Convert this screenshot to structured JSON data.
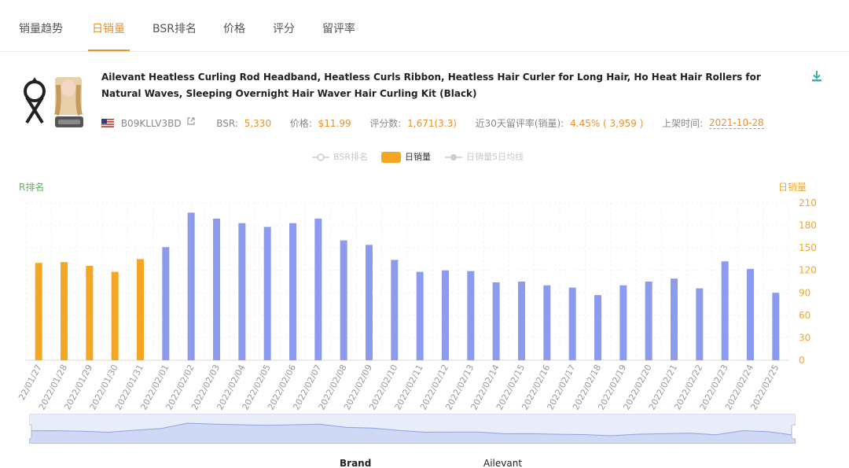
{
  "tabs": [
    {
      "label": "销量趋势",
      "active": false
    },
    {
      "label": "日销量",
      "active": true
    },
    {
      "label": "BSR排名",
      "active": false
    },
    {
      "label": "价格",
      "active": false
    },
    {
      "label": "评分",
      "active": false
    },
    {
      "label": "留评率",
      "active": false
    }
  ],
  "product": {
    "title": "Ailevant Heatless Curling Rod Headband, Heatless Curls Ribbon, Heatless Hair Curler for Long Hair, Ho Heat Hair Rollers for Natural Waves, Sleeping Overnight Hair Waver Hair Curling Kit (Black)",
    "asin": "B09KLLV3BD",
    "bsr_label": "BSR:",
    "bsr_value": "5,330",
    "price_label": "价格:",
    "price_value": "$11.99",
    "ratings_label": "评分数:",
    "ratings_value": "1,671(3.3)",
    "review_rate_label": "近30天留评率(销量):",
    "review_rate_value": "4.45% ( 3,959 )",
    "listed_label": "上架时间:",
    "listed_value": "2021-10-28"
  },
  "colors": {
    "accent": "#e8922b",
    "bar_highlight": "#f5a623",
    "bar_default": "#8d9bef",
    "left_axis": "#5cb85c",
    "right_axis": "#f5a623"
  },
  "chart_data": {
    "type": "bar",
    "legend": [
      {
        "name": "BSR排名",
        "enabled": false
      },
      {
        "name": "日销量",
        "enabled": true
      },
      {
        "name": "日销量5日均线",
        "enabled": false
      }
    ],
    "ylabel_left": "R排名",
    "ylabel_right": "日销量",
    "ylim": [
      0,
      210
    ],
    "yticks": [
      210,
      180,
      150,
      120,
      90,
      60,
      30,
      0
    ],
    "categories": [
      "2022/01/27",
      "2022/01/28",
      "2022/01/29",
      "2022/01/30",
      "2022/01/31",
      "2022/02/01",
      "2022/02/02",
      "2022/02/03",
      "2022/02/04",
      "2022/02/05",
      "2022/02/06",
      "2022/02/07",
      "2022/02/08",
      "2022/02/09",
      "2022/02/10",
      "2022/02/11",
      "2022/02/12",
      "2022/02/13",
      "2022/02/14",
      "2022/02/15",
      "2022/02/16",
      "2022/02/17",
      "2022/02/18",
      "2022/02/19",
      "2022/02/20",
      "2022/02/21",
      "2022/02/22",
      "2022/02/23",
      "2022/02/24",
      "2022/02/25"
    ],
    "tick_labels": [
      "22/01/27",
      "2022/01/28",
      "2022/01/29",
      "2022/01/30",
      "2022/01/31",
      "2022/02/01",
      "2022/02/02",
      "2022/02/03",
      "2022/02/04",
      "2022/02/05",
      "2022/02/06",
      "2022/02/07",
      "2022/02/08",
      "2022/02/09",
      "2022/02/10",
      "2022/02/11",
      "2022/02/12",
      "2022/02/13",
      "2022/02/14",
      "2022/02/15",
      "2022/02/16",
      "2022/02/17",
      "2022/02/18",
      "2022/02/19",
      "2022/02/20",
      "2022/02/21",
      "2022/02/22",
      "2022/02/23",
      "2022/02/24",
      "2022/02/25"
    ],
    "series": [
      {
        "name": "日销量",
        "values": [
          130,
          131,
          126,
          118,
          135,
          151,
          197,
          189,
          183,
          178,
          183,
          189,
          160,
          154,
          134,
          118,
          120,
          119,
          104,
          105,
          100,
          97,
          87,
          100,
          105,
          109,
          96,
          132,
          122,
          90
        ]
      }
    ],
    "highlighted_indices": [
      0,
      1,
      2,
      3,
      4
    ]
  },
  "bottom": {
    "left_text": "Brand",
    "right_text": "Ailevant"
  }
}
